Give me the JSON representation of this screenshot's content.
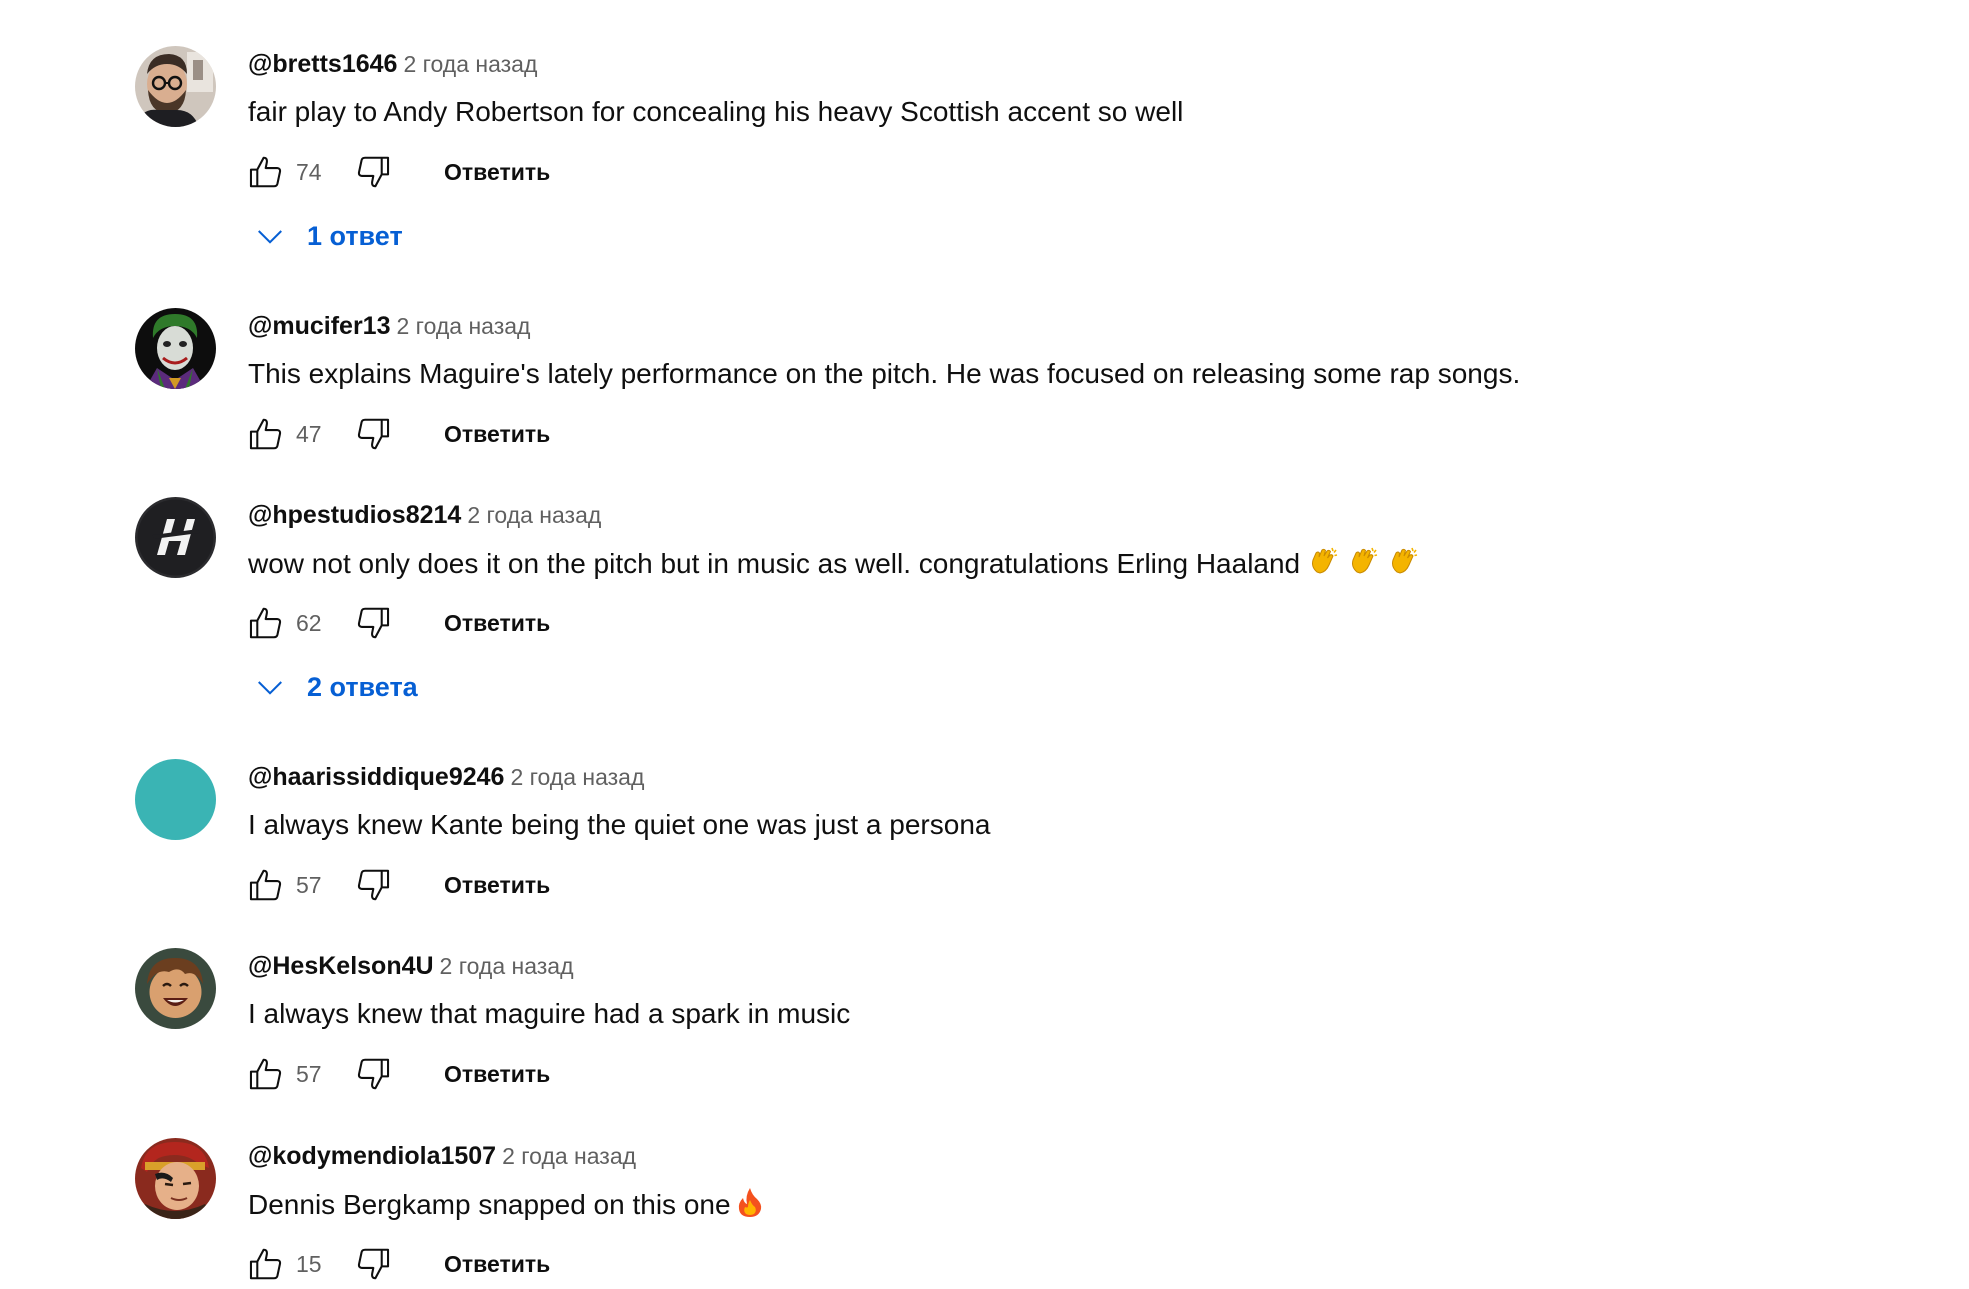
{
  "comments": [
    {
      "author": "@bretts1646",
      "time": "2 года назад",
      "text": "fair play to Andy Robertson for concealing his heavy Scottish accent so well",
      "likes": "74",
      "reply_label": "Ответить",
      "replies_label": "1 ответ",
      "avatar": "person-with-glasses-avatar",
      "emoji": []
    },
    {
      "author": "@mucifer13",
      "time": "2 года назад",
      "text": "This explains Maguire's lately performance on the pitch. He was focused on releasing some rap songs.",
      "likes": "47",
      "reply_label": "Ответить",
      "replies_label": "",
      "avatar": "joker-avatar",
      "emoji": []
    },
    {
      "author": "@hpestudios8214",
      "time": "2 года назад",
      "text": "wow not only does it on the pitch but in music as well. congratulations Erling Haaland",
      "likes": "62",
      "reply_label": "Ответить",
      "replies_label": "2 ответа",
      "avatar": "hp-logo-avatar",
      "emoji": [
        "clapping-hands-icon",
        "clapping-hands-icon",
        "clapping-hands-icon"
      ]
    },
    {
      "author": "@haarissiddique9246",
      "time": "2 года назад",
      "text": "I always knew Kante being the quiet one was just a persona",
      "likes": "57",
      "reply_label": "Ответить",
      "replies_label": "",
      "avatar": "teal-circle-avatar",
      "emoji": []
    },
    {
      "author": "@HesKelson4U",
      "time": "2 года назад",
      "text": "I always knew that maguire had a spark in music",
      "likes": "57",
      "reply_label": "Ответить",
      "replies_label": "",
      "avatar": "cartoon-laughing-avatar",
      "emoji": []
    },
    {
      "author": "@kodymendiola1507",
      "time": "2 года назад",
      "text": "Dennis Bergkamp snapped on this one",
      "likes": "15",
      "reply_label": "Ответить",
      "replies_label": "",
      "avatar": "anime-character-avatar",
      "emoji": [
        "fire-icon"
      ]
    }
  ],
  "colors": {
    "author": "#0f0f0f",
    "time": "#606060",
    "replies_link": "#065fd4",
    "teal_avatar": "#3ab4b4"
  }
}
